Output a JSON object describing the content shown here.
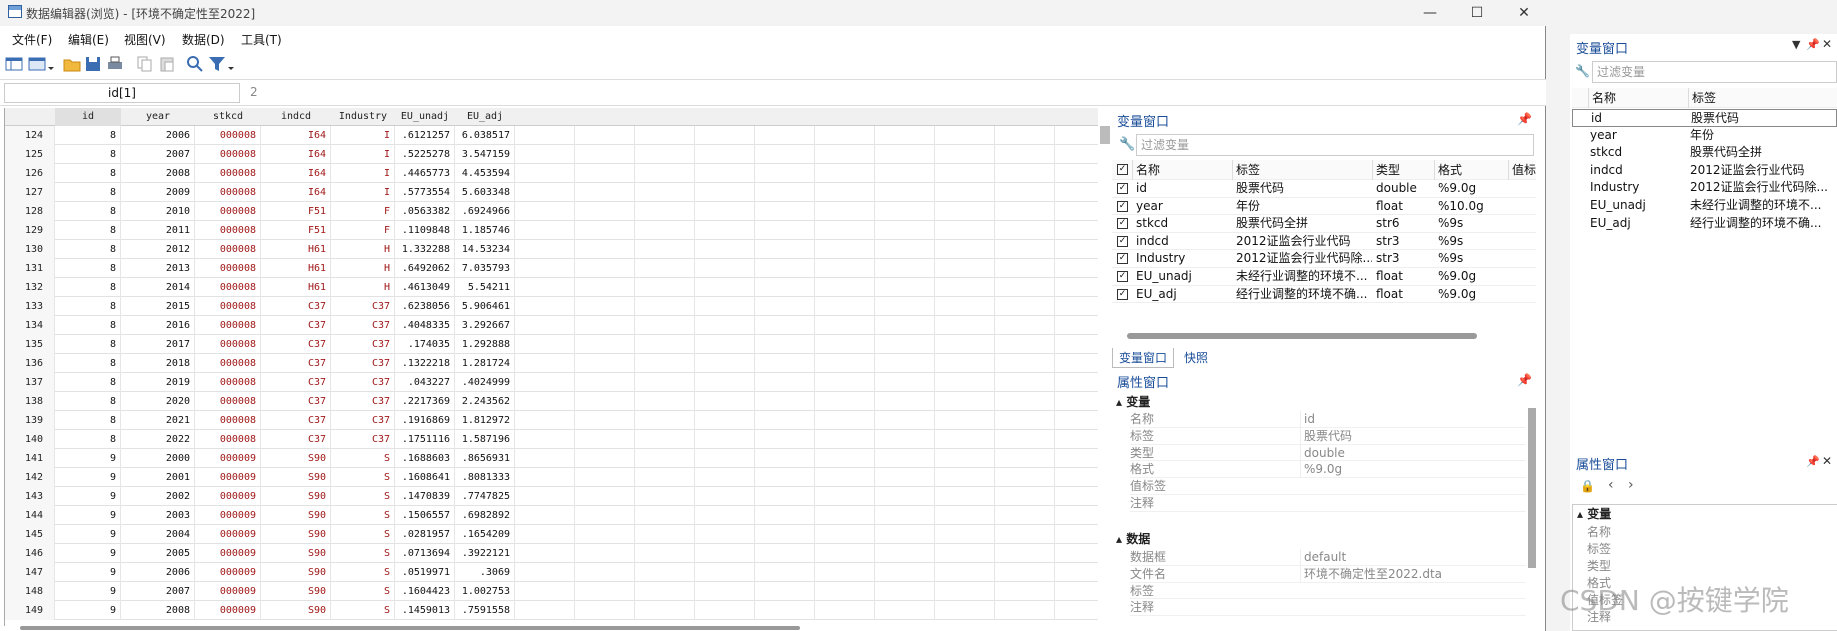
{
  "window": {
    "title": "数据编辑器(浏览) - [环境不确定性至2022]",
    "min": "—",
    "max": "☐",
    "close": "✕"
  },
  "menu": [
    "文件(F)",
    "编辑(E)",
    "视图(V)",
    "数据(D)",
    "工具(T)"
  ],
  "toolbar_icons": [
    "data-editor-icon",
    "browse-icon",
    "open-icon",
    "save-icon",
    "print-icon",
    "copy-icon",
    "paste-icon",
    "find-icon",
    "filter-icon"
  ],
  "cellbar": {
    "name": "id[1]",
    "value": "2"
  },
  "grid": {
    "columns": [
      "id",
      "year",
      "stkcd",
      "indcd",
      "Industry",
      "EU_unadj",
      "EU_adj"
    ],
    "rows": [
      [
        "124",
        "8",
        "2006",
        "000008",
        "I64",
        "I",
        ".6121257",
        "6.038517"
      ],
      [
        "125",
        "8",
        "2007",
        "000008",
        "I64",
        "I",
        ".5225278",
        "3.547159"
      ],
      [
        "126",
        "8",
        "2008",
        "000008",
        "I64",
        "I",
        ".4465773",
        "4.453594"
      ],
      [
        "127",
        "8",
        "2009",
        "000008",
        "I64",
        "I",
        ".5773554",
        "5.603348"
      ],
      [
        "128",
        "8",
        "2010",
        "000008",
        "F51",
        "F",
        ".0563382",
        ".6924966"
      ],
      [
        "129",
        "8",
        "2011",
        "000008",
        "F51",
        "F",
        ".1109848",
        "1.185746"
      ],
      [
        "130",
        "8",
        "2012",
        "000008",
        "H61",
        "H",
        "1.332288",
        "14.53234"
      ],
      [
        "131",
        "8",
        "2013",
        "000008",
        "H61",
        "H",
        ".6492062",
        "7.035793"
      ],
      [
        "132",
        "8",
        "2014",
        "000008",
        "H61",
        "H",
        ".4613049",
        "5.54211"
      ],
      [
        "133",
        "8",
        "2015",
        "000008",
        "C37",
        "C37",
        ".6238056",
        "5.906461"
      ],
      [
        "134",
        "8",
        "2016",
        "000008",
        "C37",
        "C37",
        ".4048335",
        "3.292667"
      ],
      [
        "135",
        "8",
        "2017",
        "000008",
        "C37",
        "C37",
        ".174035",
        "1.292888"
      ],
      [
        "136",
        "8",
        "2018",
        "000008",
        "C37",
        "C37",
        ".1322218",
        "1.281724"
      ],
      [
        "137",
        "8",
        "2019",
        "000008",
        "C37",
        "C37",
        ".043227",
        ".4024999"
      ],
      [
        "138",
        "8",
        "2020",
        "000008",
        "C37",
        "C37",
        ".2217369",
        "2.243562"
      ],
      [
        "139",
        "8",
        "2021",
        "000008",
        "C37",
        "C37",
        ".1916869",
        "1.812972"
      ],
      [
        "140",
        "8",
        "2022",
        "000008",
        "C37",
        "C37",
        ".1751116",
        "1.587196"
      ],
      [
        "141",
        "9",
        "2000",
        "000009",
        "S90",
        "S",
        ".1688603",
        ".8656931"
      ],
      [
        "142",
        "9",
        "2001",
        "000009",
        "S90",
        "S",
        ".1608641",
        ".8081333"
      ],
      [
        "143",
        "9",
        "2002",
        "000009",
        "S90",
        "S",
        ".1470839",
        ".7747825"
      ],
      [
        "144",
        "9",
        "2003",
        "000009",
        "S90",
        "S",
        ".1506557",
        ".6982892"
      ],
      [
        "145",
        "9",
        "2004",
        "000009",
        "S90",
        "S",
        ".0281957",
        ".1654209"
      ],
      [
        "146",
        "9",
        "2005",
        "000009",
        "S90",
        "S",
        ".0713694",
        ".3922121"
      ],
      [
        "147",
        "9",
        "2006",
        "000009",
        "S90",
        "S",
        ".0519971",
        ".3069"
      ],
      [
        "148",
        "9",
        "2007",
        "000009",
        "S90",
        "S",
        ".1604423",
        "1.002753"
      ],
      [
        "149",
        "9",
        "2008",
        "000009",
        "S90",
        "S",
        ".1459013",
        ".7591558"
      ]
    ]
  },
  "varwin": {
    "title": "变量窗口",
    "filter_placeholder": "过滤变量",
    "headers": [
      "名称",
      "标签",
      "类型",
      "格式",
      "值标签"
    ],
    "vars": [
      [
        "id",
        "股票代码",
        "double",
        "%9.0g"
      ],
      [
        "year",
        "年份",
        "float",
        "%10.0g"
      ],
      [
        "stkcd",
        "股票代码全拼",
        "str6",
        "%9s"
      ],
      [
        "indcd",
        "2012证监会行业代码",
        "str3",
        "%9s"
      ],
      [
        "Industry",
        "2012证监会行业代码除...",
        "str3",
        "%9s"
      ],
      [
        "EU_unadj",
        "未经行业调整的环境不...",
        "float",
        "%9.0g"
      ],
      [
        "EU_adj",
        "经行业调整的环境不确...",
        "float",
        "%9.0g"
      ]
    ],
    "tabs": [
      "变量窗口",
      "快照"
    ]
  },
  "propwin": {
    "title": "属性窗口",
    "sec_var": "变量",
    "var_rows": [
      [
        "名称",
        "id"
      ],
      [
        "标签",
        "股票代码"
      ],
      [
        "类型",
        "double"
      ],
      [
        "格式",
        "%9.0g"
      ],
      [
        "值标签",
        ""
      ],
      [
        "注释",
        ""
      ]
    ],
    "sec_data": "数据",
    "data_rows": [
      [
        "数据框",
        "default"
      ],
      [
        "文件名",
        "环境不确定性至2022.dta"
      ],
      [
        "标签",
        ""
      ],
      [
        "注释",
        ""
      ]
    ]
  },
  "right": {
    "varwin_title": "变量窗口",
    "filter_placeholder": "过滤变量",
    "headers": [
      "名称",
      "标签"
    ],
    "vars": [
      [
        "id",
        "股票代码"
      ],
      [
        "year",
        "年份"
      ],
      [
        "stkcd",
        "股票代码全拼"
      ],
      [
        "indcd",
        "2012证监会行业代码"
      ],
      [
        "Industry",
        "2012证监会行业代码除..."
      ],
      [
        "EU_unadj",
        "未经行业调整的环境不..."
      ],
      [
        "EU_adj",
        "经行业调整的环境不确..."
      ]
    ],
    "propwin_title": "属性窗口",
    "prop_sec": "变量",
    "prop_labels": [
      "名称",
      "标签",
      "类型",
      "格式",
      "值标签",
      "注释"
    ],
    "watermark": "CSDN @按键学院"
  }
}
